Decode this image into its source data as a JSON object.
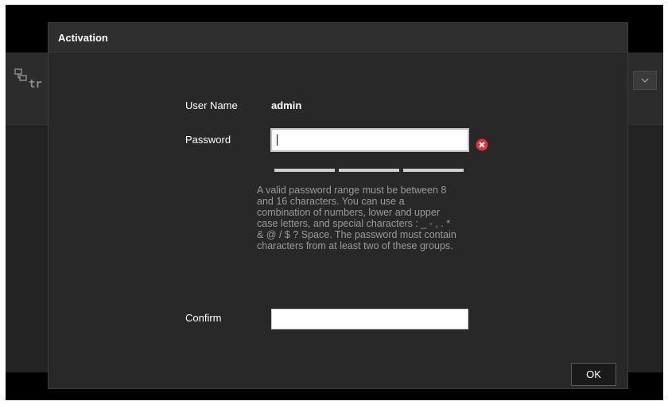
{
  "dialog": {
    "title": "Activation",
    "user_name_label": "User Name",
    "user_name_value": "admin",
    "password_label": "Password",
    "password_value": "",
    "confirm_label": "Confirm",
    "confirm_value": "",
    "hint": "A valid password range must be between 8 and 16 characters. You can use a combination of numbers, lower and upper case letters, and special characters : _ - , . * & @ / $ ? Space. The password must contain characters from at least two of these groups.",
    "ok_label": "OK",
    "password_strength_segments": 3,
    "password_strength_filled": 0
  },
  "background": {
    "logo_text": "tr",
    "logo_icon": "network-icon",
    "dropdown_icon": "chevron-down-icon"
  },
  "colors": {
    "clear_icon": "#e0303a",
    "strength_bar": "#cfcfcf",
    "hint_text": "#9a9a9a"
  }
}
